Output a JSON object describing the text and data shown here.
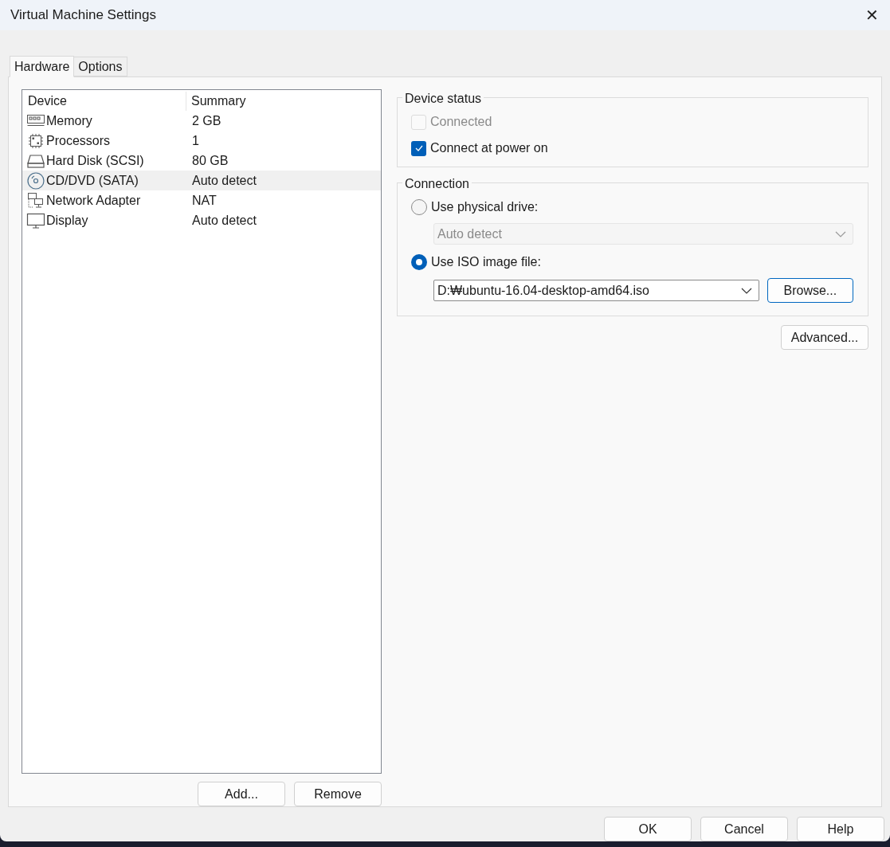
{
  "window": {
    "title": "Virtual Machine Settings",
    "close": "✕"
  },
  "tabs": [
    {
      "label": "Hardware",
      "selected": true
    },
    {
      "label": "Options",
      "selected": false
    }
  ],
  "device_list": {
    "columns": [
      "Device",
      "Summary"
    ],
    "rows": [
      {
        "kind": "memory",
        "device": "Memory",
        "summary": "2 GB",
        "selected": false
      },
      {
        "kind": "processor",
        "device": "Processors",
        "summary": "1",
        "selected": false
      },
      {
        "kind": "disk",
        "device": "Hard Disk (SCSI)",
        "summary": "80 GB",
        "selected": false
      },
      {
        "kind": "cd",
        "device": "CD/DVD (SATA)",
        "summary": "Auto detect",
        "selected": true
      },
      {
        "kind": "network",
        "device": "Network Adapter",
        "summary": "NAT",
        "selected": false
      },
      {
        "kind": "display",
        "device": "Display",
        "summary": "Auto detect",
        "selected": false
      }
    ],
    "buttons": [
      "Add...",
      "Remove"
    ]
  },
  "device_status": {
    "title": "Device status",
    "options": [
      {
        "label": "Connected",
        "checked": false,
        "disabled": true
      },
      {
        "label": "Connect at power on",
        "checked": true,
        "disabled": false
      }
    ]
  },
  "connection": {
    "title": "Connection",
    "physical": {
      "label": "Use physical drive:",
      "selected": false,
      "drive": "Auto detect",
      "disabled": true
    },
    "iso": {
      "label": "Use ISO image file:",
      "selected": true,
      "path": "D:₩ubuntu-16.04-desktop-amd64.iso",
      "browse": "Browse..."
    }
  },
  "advanced": "Advanced...",
  "footer_buttons": [
    "OK",
    "Cancel",
    "Help"
  ]
}
